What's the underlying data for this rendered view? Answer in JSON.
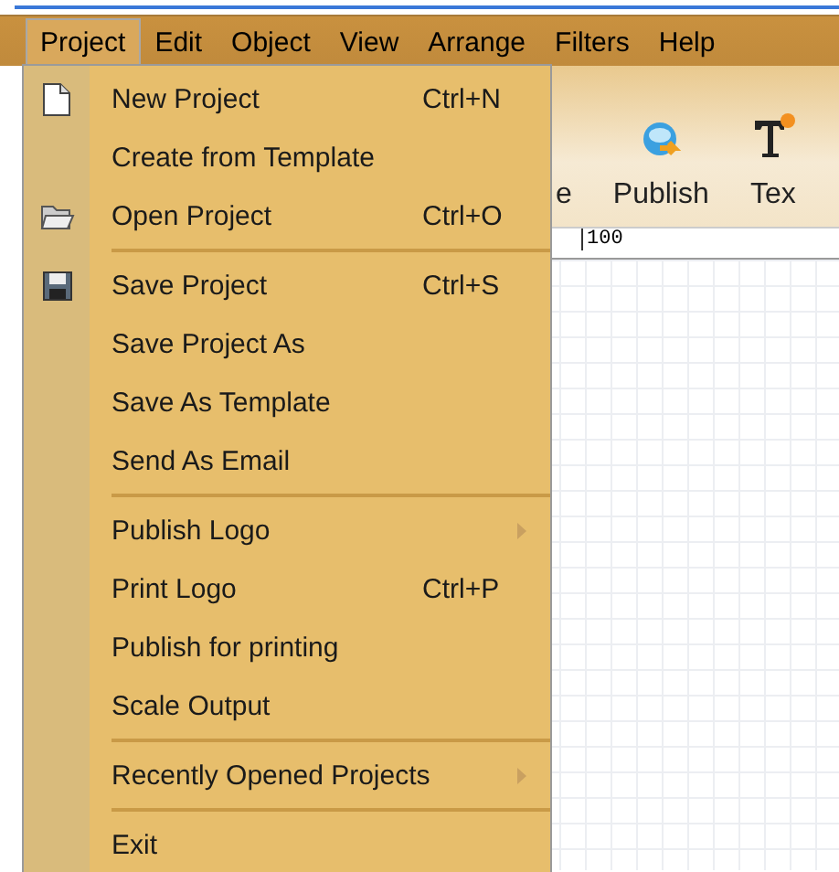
{
  "menu_bar": [
    {
      "label": "Project",
      "selected": true
    },
    {
      "label": "Edit",
      "selected": false
    },
    {
      "label": "Object",
      "selected": false
    },
    {
      "label": "View",
      "selected": false
    },
    {
      "label": "Arrange",
      "selected": false
    },
    {
      "label": "Filters",
      "selected": false
    },
    {
      "label": "Help",
      "selected": false
    }
  ],
  "toolbar": [
    {
      "label": "e",
      "kind": "text"
    },
    {
      "label": "Publish",
      "kind": "publish"
    },
    {
      "label": "Tex",
      "kind": "text-tool"
    }
  ],
  "ruler": {
    "label": "100"
  },
  "project_menu": [
    {
      "kind": "item",
      "label": "New Project",
      "shortcut": "Ctrl+N"
    },
    {
      "kind": "item",
      "label": "Create from Template"
    },
    {
      "kind": "item",
      "label": "Open Project",
      "shortcut": "Ctrl+O"
    },
    {
      "kind": "separator"
    },
    {
      "kind": "item",
      "label": "Save Project",
      "shortcut": "Ctrl+S"
    },
    {
      "kind": "item",
      "label": "Save Project As"
    },
    {
      "kind": "item",
      "label": "Save As Template"
    },
    {
      "kind": "item",
      "label": "Send As Email"
    },
    {
      "kind": "separator"
    },
    {
      "kind": "submenu",
      "label": "Publish Logo"
    },
    {
      "kind": "item",
      "label": "Print Logo",
      "shortcut": "Ctrl+P"
    },
    {
      "kind": "item",
      "label": "Publish for printing"
    },
    {
      "kind": "item",
      "label": "Scale Output"
    },
    {
      "kind": "separator"
    },
    {
      "kind": "submenu",
      "label": "Recently Opened Projects"
    },
    {
      "kind": "separator"
    },
    {
      "kind": "item",
      "label": "Exit"
    }
  ]
}
